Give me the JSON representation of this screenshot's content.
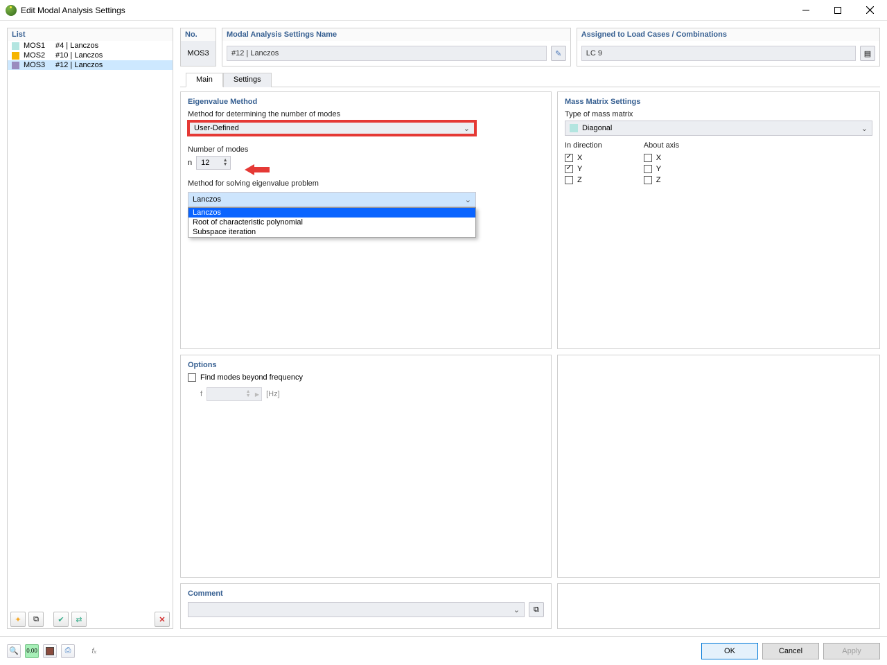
{
  "window": {
    "title": "Edit Modal Analysis Settings"
  },
  "list": {
    "title": "List",
    "items": [
      {
        "code": "MOS1",
        "name": "#4 | Lanczos",
        "color": "sw-cy",
        "selected": false
      },
      {
        "code": "MOS2",
        "name": "#10 | Lanczos",
        "color": "sw-y",
        "selected": false
      },
      {
        "code": "MOS3",
        "name": "#12 | Lanczos",
        "color": "sw-pu",
        "selected": true
      }
    ]
  },
  "header": {
    "no_label": "No.",
    "no_value": "MOS3",
    "name_label": "Modal Analysis Settings Name",
    "name_value": "#12 | Lanczos",
    "assigned_label": "Assigned to Load Cases / Combinations",
    "assigned_value": "LC 9"
  },
  "tabs": {
    "main": "Main",
    "settings": "Settings"
  },
  "eigen": {
    "title": "Eigenvalue Method",
    "method_label": "Method for determining the number of modes",
    "method_value": "User-Defined",
    "modes_label": "Number of modes",
    "modes_symbol": "n",
    "modes_value": "12",
    "solver_label": "Method for solving eigenvalue problem",
    "solver_value": "Lanczos",
    "solver_opts": [
      "Lanczos",
      "Root of characteristic polynomial",
      "Subspace iteration"
    ]
  },
  "options": {
    "title": "Options",
    "beyond_label": "Find modes beyond frequency",
    "freq_symbol": "f",
    "freq_unit": "[Hz]"
  },
  "mass": {
    "title": "Mass Matrix Settings",
    "type_label": "Type of mass matrix",
    "type_value": "Diagonal",
    "dir_label": "In direction",
    "axis_label": "About axis",
    "dir": {
      "x": true,
      "y": true,
      "z": false
    },
    "axis": {
      "x": false,
      "y": false,
      "z": false
    },
    "labels": {
      "x": "X",
      "y": "Y",
      "z": "Z"
    }
  },
  "comment": {
    "title": "Comment"
  },
  "footer": {
    "ok": "OK",
    "cancel": "Cancel",
    "apply": "Apply",
    "num_label": "0,00"
  }
}
